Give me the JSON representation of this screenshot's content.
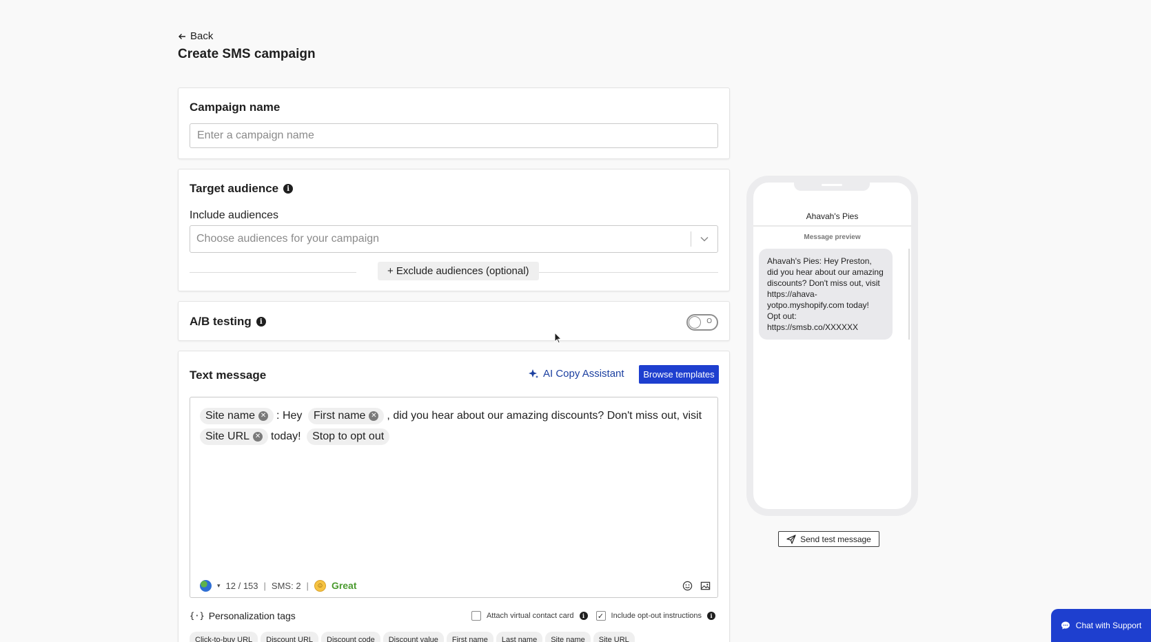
{
  "header": {
    "back_label": "Back",
    "title": "Create SMS campaign"
  },
  "campaign_name": {
    "title": "Campaign name",
    "placeholder": "Enter a campaign name",
    "value": ""
  },
  "target_audience": {
    "title": "Target audience",
    "include_label": "Include audiences",
    "select_placeholder": "Choose audiences for your campaign",
    "exclude_button": "+ Exclude audiences (optional)"
  },
  "ab_testing": {
    "title": "A/B testing",
    "toggle_state": "off",
    "toggle_text": "O"
  },
  "text_message": {
    "title": "Text message",
    "ai_button": "AI Copy Assistant",
    "browse_button": "Browse templates",
    "segments": [
      {
        "type": "chip",
        "text": "Site name",
        "removable": true
      },
      {
        "type": "text",
        "text": ": Hey"
      },
      {
        "type": "chip",
        "text": "First name",
        "removable": true
      },
      {
        "type": "text",
        "text": ", did you hear about our amazing discounts? Don't miss out, visit"
      },
      {
        "type": "chip",
        "text": "Site URL",
        "removable": true
      },
      {
        "type": "text",
        "text": "today!"
      },
      {
        "type": "chip",
        "text": "Stop to opt out",
        "removable": false
      }
    ],
    "char_count": "12 / 153",
    "sms_count": "SMS: 2",
    "quality": "Great",
    "personalization_label": "Personalization tags",
    "attach_vcard_label": "Attach virtual contact card",
    "attach_vcard_checked": false,
    "opt_out_label": "Include opt-out instructions",
    "opt_out_checked": true,
    "tags": [
      "Click-to-buy URL",
      "Discount URL",
      "Discount code",
      "Discount value",
      "First name",
      "Last name",
      "Site name",
      "Site URL"
    ]
  },
  "preview": {
    "store_name": "Ahavah's Pies",
    "subtitle": "Message preview",
    "message": "Ahavah's Pies: Hey Preston, did you hear about our amazing discounts? Don't miss out, visit https://ahava-yotpo.myshopify.com today! Opt out: https://smsb.co/XXXXXX",
    "send_test_label": "Send test message"
  },
  "support": {
    "chat_label": "Chat with Support"
  },
  "colors": {
    "primary": "#1e3fcf",
    "ai_accent": "#1b3fa0",
    "quality_good": "#4a9a2e"
  }
}
